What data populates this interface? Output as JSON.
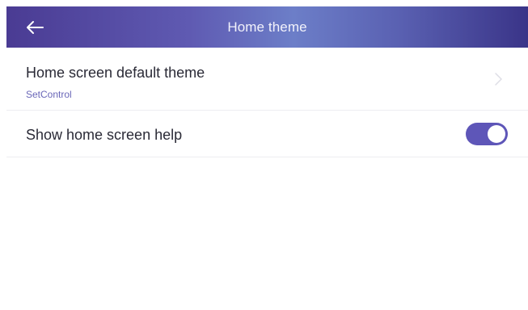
{
  "header": {
    "title": "Home theme",
    "back_icon": "arrow-left-icon",
    "gradient_colors": [
      "#4a3b93",
      "#6c7ec8",
      "#3a3488"
    ]
  },
  "settings": [
    {
      "title": "Home screen default theme",
      "subtitle": "SetControl",
      "control": "chevron-right-icon"
    },
    {
      "title": "Show home screen help",
      "control": "toggle",
      "toggle_on": true
    }
  ],
  "colors": {
    "accent": "#5e56b8",
    "subtitle": "#6a67b8",
    "text": "#2a2a36",
    "divider": "#ededf1"
  }
}
